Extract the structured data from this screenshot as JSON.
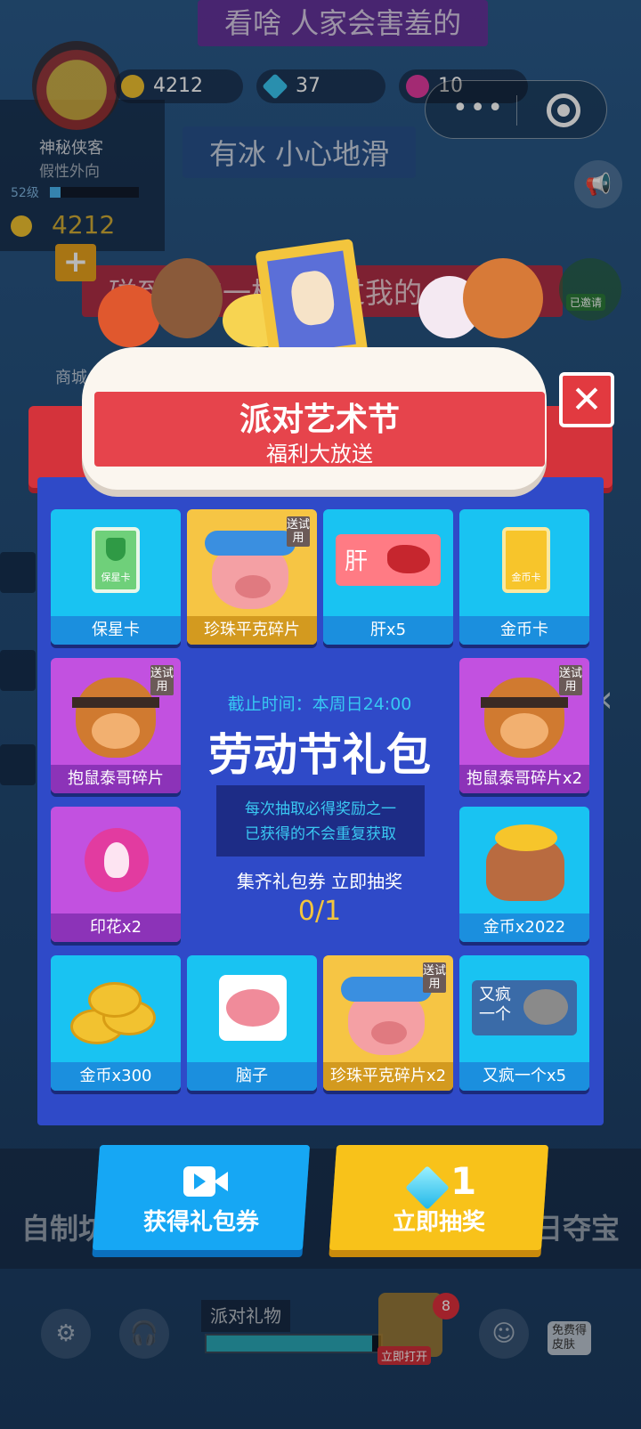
{
  "background": {
    "danmaku": [
      "看啥 人家会害羞的",
      "有冰 小心地滑",
      "碰到跟神一样的不过我的人"
    ],
    "profile": {
      "name": "神秘侠客",
      "subtitle": "假性外向",
      "level": "52级",
      "level_progress": 0.12,
      "coins": "4212"
    },
    "currencies": [
      {
        "icon": "coin-icon",
        "value": "4212",
        "color": "#f2c230"
      },
      {
        "icon": "diamond-icon",
        "value": "37",
        "color": "#39c6f2"
      },
      {
        "icon": "lotus-icon",
        "value": "10",
        "color": "#e23ba0"
      }
    ],
    "side": {
      "badge_label": "已邀请",
      "shop_label": "商城"
    },
    "bottom": {
      "left_label": "自制坊",
      "right_label": "日夺宝",
      "gift_label": "派对礼物",
      "gift_progress": 0.95,
      "open_tag": "立即打开",
      "notification_count": "8",
      "free_tag_line1": "免费得",
      "free_tag_line2": "皮肤"
    }
  },
  "modal": {
    "title": "派对艺术节",
    "subtitle": "福利大放送",
    "close_icon": "close-icon",
    "trial_tag": "送试用",
    "rewards": [
      {
        "label": "保星卡",
        "art": "star-shield-card-icon",
        "card_text": "保星卡"
      },
      {
        "label": "珍珠平克碎片",
        "art": "pig-character-icon"
      },
      {
        "label": "肝x5",
        "art": "liver-sign-icon",
        "sign_text": "肝"
      },
      {
        "label": "金币卡",
        "art": "gold-card-icon",
        "card_text": "金币卡"
      },
      {
        "label": "抱鼠泰哥碎片",
        "art": "monkey-character-icon"
      },
      {
        "label": "抱鼠泰哥碎片x2",
        "art": "monkey-character-icon"
      },
      {
        "label": "印花x2",
        "art": "lotus-icon"
      },
      {
        "label": "金币x2022",
        "art": "gold-sack-icon"
      },
      {
        "label": "金币x300",
        "art": "coins-icon"
      },
      {
        "label": "脑子",
        "art": "brain-icon"
      },
      {
        "label": "珍珠平克碎片x2",
        "art": "pig-character-icon"
      },
      {
        "label": "又疯一个x5",
        "art": "mad-bull-sign-icon",
        "sign_text_line1": "又疯",
        "sign_text_line2": "一个"
      }
    ],
    "center": {
      "deadline": "截止时间：本周日24:00",
      "pack_title": "劳动节礼包",
      "rule_line1": "每次抽取必得奖励之一",
      "rule_line2": "已获得的不会重复获取",
      "collect_text": "集齐礼包券 立即抽奖",
      "progress": "0/1"
    },
    "buttons": {
      "get_ticket": "获得礼包券",
      "draw_now": "立即抽奖",
      "draw_cost": "1"
    }
  },
  "system": {
    "capsule_menu_icon": "more-icon",
    "capsule_close_icon": "target-icon"
  }
}
